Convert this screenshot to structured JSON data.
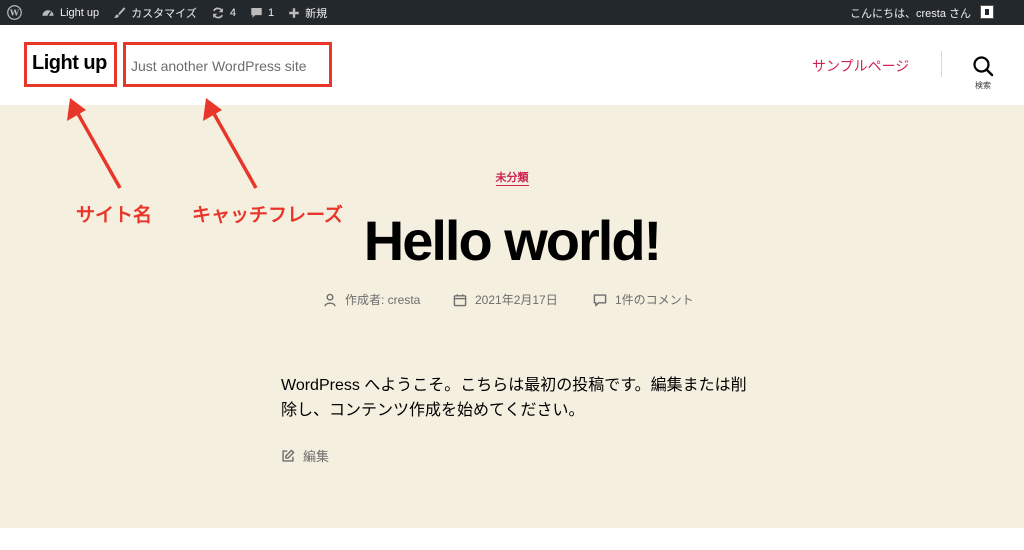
{
  "adminbar": {
    "site_name": "Light up",
    "customize": "カスタマイズ",
    "updates_count": "4",
    "comments_count": "1",
    "new_label": "新規",
    "greeting": "こんにちは、cresta さん"
  },
  "header": {
    "site_title": "Light up",
    "tagline": "Just another WordPress site",
    "nav_link": "サンプルページ",
    "search_label": "検索"
  },
  "post": {
    "category": "未分類",
    "title": "Hello world!",
    "author": "作成者: cresta",
    "date": "2021年2月17日",
    "comments": "1件のコメント",
    "body": "WordPress へようこそ。こちらは最初の投稿です。編集または削除し、コンテンツ作成を始めてください。",
    "edit": "編集"
  },
  "annotations": {
    "site_name_label": "サイト名",
    "tagline_label": "キャッチフレーズ",
    "color": "#e8372a"
  },
  "colors": {
    "accent": "#cd2653",
    "background": "#f5efe0",
    "adminbar": "#23282d"
  }
}
